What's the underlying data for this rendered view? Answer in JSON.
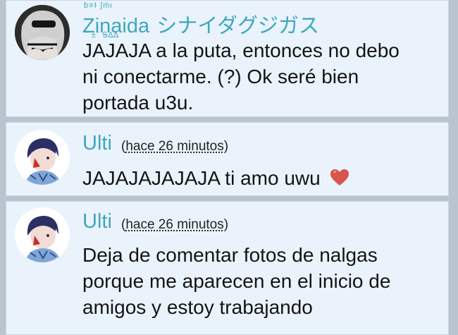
{
  "comments": [
    {
      "author": "Zinaida",
      "author_suffix": "シナイダグジガス",
      "name_deco_top": "ɓ≡ɫ ∫ḿι",
      "name_deco_bottom": "ˆ ±ˆ  Ꞩ∆∆",
      "time_prefix": "",
      "time": "",
      "time_suffix": "",
      "message_lines": [
        "JAJAJA a la puta, entonces no debo",
        "ni conectarme. (?) Ok seré bien",
        "portada u3u."
      ],
      "emoji": ""
    },
    {
      "author": "Ulti",
      "author_suffix": "",
      "time_prefix": "(",
      "time": "hace 26 minutos",
      "time_suffix": ")",
      "message_lines": [
        "JAJAJAJAJAJA ti amo uwu"
      ],
      "emoji": "heart-emoji"
    },
    {
      "author": "Ulti",
      "author_suffix": "",
      "time_prefix": "(",
      "time": "hace 26 minutos",
      "time_suffix": ")",
      "message_lines": [
        "Deja de comentar fotos de nalgas",
        "porque me aparecen en el inicio de",
        "amigos y estoy trabajando"
      ],
      "emoji": ""
    }
  ],
  "colors": {
    "card_bg": "#eaf3fc",
    "page_bg": "#b9c4cf",
    "name": "#3fa7be",
    "heart": "#d9534f"
  }
}
